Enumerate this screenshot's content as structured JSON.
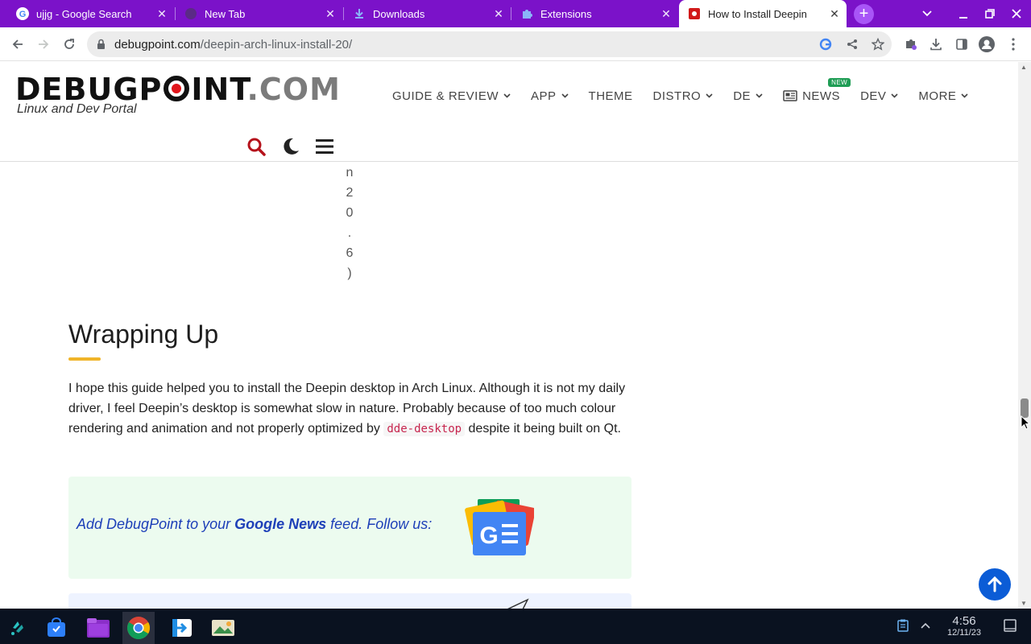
{
  "browser": {
    "tabs": [
      {
        "title": "ujjg - Google Search",
        "favicon": "google-icon"
      },
      {
        "title": "New Tab",
        "favicon": "chrome-newtab-icon"
      },
      {
        "title": "Downloads",
        "favicon": "download-icon"
      },
      {
        "title": "Extensions",
        "favicon": "puzzle-icon"
      },
      {
        "title": "How to Install Deepin",
        "favicon": "debugpoint-icon",
        "active": true
      }
    ],
    "new_tab_label": "+",
    "url_domain": "debugpoint.com",
    "url_path": "/deepin-arch-linux-install-20/",
    "tabstrip_color": "#7b12c9"
  },
  "site": {
    "logo_main": "DEBUGP",
    "logo_tail": "INT",
    "logo_com": ".COM",
    "tagline": "Linux and Dev Portal",
    "nav": [
      {
        "label": "GUIDE & REVIEW",
        "dropdown": true
      },
      {
        "label": "APP",
        "dropdown": true
      },
      {
        "label": "THEME",
        "dropdown": false
      },
      {
        "label": "DISTRO",
        "dropdown": true
      },
      {
        "label": "DE",
        "dropdown": true
      },
      {
        "label": "NEWS",
        "dropdown": false,
        "badge": "NEW",
        "icon": "newspaper-icon"
      },
      {
        "label": "DEV",
        "dropdown": true
      },
      {
        "label": "MORE",
        "dropdown": true
      }
    ]
  },
  "article": {
    "vertical_chars": [
      "n",
      "2",
      "0",
      ".",
      "6",
      ")"
    ],
    "heading": "Wrapping Up",
    "paragraph_before_code": "I hope this guide helped you to install the Deepin desktop in Arch Linux. Although it is not my daily driver, I feel Deepin’s desktop is somewhat slow in nature. Probably because of too much colour rendering and animation and not properly optimized by ",
    "code": "dde-desktop",
    "paragraph_after_code": " despite it being built on Qt.",
    "gnews": {
      "prefix": "Add DebugPoint to your ",
      "brand": "Google News",
      "suffix": " feed. Follow us:"
    }
  },
  "taskbar": {
    "time": "4:56",
    "date": "12/11/23",
    "apps": [
      "launcher-icon",
      "store-icon",
      "files-icon",
      "chrome-icon",
      "transfer-icon",
      "photos-icon"
    ]
  },
  "colors": {
    "accent_blue": "#0b5cd6",
    "underline_gold": "#f0b429",
    "gnews_bg": "#ecfbef",
    "logo_red": "#e0151b"
  }
}
